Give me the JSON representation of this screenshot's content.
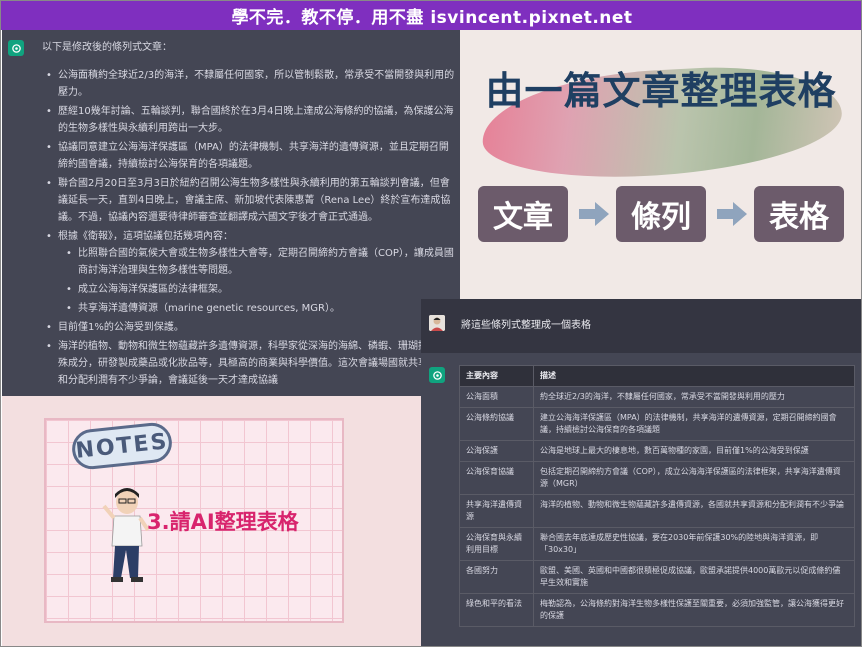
{
  "banner": {
    "text": "學不完．教不停．用不盡 isvincent.pixnet.net"
  },
  "chat_left": {
    "intro": "以下是修改後的條列式文章：",
    "bullets": [
      "公海面積約全球近2/3的海洋，不隸屬任何國家，所以管制鬆散，常承受不當開發與利用的壓力。",
      "歷經10幾年討論、五輪談判，聯合國終於在3月4日晚上達成公海條約的協議，為保護公海的生物多樣性與永續利用跨出一大步。",
      "協議同意建立公海海洋保護區（MPA）的法律機制、共享海洋的遺傳資源，並且定期召開締約國會議，持續檢討公海保育的各項議題。",
      "聯合國2月20日至3月3日於紐約召開公海生物多樣性與永續利用的第五輪談判會議，但會議延長一天，直到4日晚上，會議主席、新加坡代表陳惠菁（Rena Lee）終於宣布達成協議。不過，協議內容還要待律師審查並翻譯成六國文字後才會正式通過。",
      "根據《衛報》，這項協議包括幾項內容："
    ],
    "sub_bullets": [
      "比照聯合國的氣候大會或生物多樣性大會等，定期召開締約方會議（COP），讓成員國商討海洋治理與生物多樣性等問題。",
      "成立公海海洋保護區的法律框架。",
      "共享海洋遺傳資源（marine genetic resources, MGR）。"
    ],
    "bullets_after": [
      "目前僅1%的公海受到保護。",
      "海洋的植物、動物和微生物蘊藏許多遺傳資源，科學家從深海的海綿、磷蝦、珊瑚提取特殊成分，研發製成藥品或化妝品等，具極高的商業與科學價值。這次會議場國就共享資源和分配利潤有不少爭論，會議延後一天才達成協議"
    ]
  },
  "title_card": {
    "title": "由一篇文章整理表格",
    "flow": [
      "文章",
      "條列",
      "表格"
    ]
  },
  "notes_card": {
    "tag": "NOTES",
    "caption": "3.請AI整理表格"
  },
  "chat_right": {
    "user_message": "將這些條列式整理成一個表格",
    "table": {
      "headers": [
        "主要內容",
        "描述"
      ],
      "rows": [
        [
          "公海面積",
          "約全球近2/3的海洋，不隸屬任何國家，常承受不當開發與利用的壓力"
        ],
        [
          "公海條約協議",
          "建立公海海洋保護區（MPA）的法律機制，共享海洋的遺傳資源，定期召開締約國會議，持續檢討公海保育的各項議題"
        ],
        [
          "公海保護",
          "公海是地球上最大的棲息地，數百萬物種的家園，目前僅1%的公海受到保護"
        ],
        [
          "公海保育協議",
          "包括定期召開締約方會議（COP），成立公海海洋保護區的法律框架，共享海洋遺傳資源（MGR）"
        ],
        [
          "共享海洋遺傳資源",
          "海洋的植物、動物和微生物蘊藏許多遺傳資源，各國就共享資源和分配利潤有不少爭論"
        ],
        [
          "公海保育與永續利用目標",
          "聯合國去年底達成歷史性協議，要在2030年前保護30%的陸地與海洋資源，即「30x30」"
        ],
        [
          "各國努力",
          "歐盟、美國、英國和中國都很積極促成協議，歐盟承諾提供4000萬歐元以促成條約儘早生效和實施"
        ],
        [
          "綠色和平的看法",
          "梅勒認為，公海條約對海洋生物多樣性保護至關重要，必須加強監管，讓公海獲得更好的保護"
        ]
      ]
    }
  },
  "colors": {
    "banner": "#7f2fbf",
    "chat_dark": "#444654",
    "chat_darker": "#343541",
    "gpt_green": "#10a37f",
    "title_blue": "#1f3f62",
    "flow_box": "#6c5b6b",
    "notes_pink": "#d8246d"
  }
}
